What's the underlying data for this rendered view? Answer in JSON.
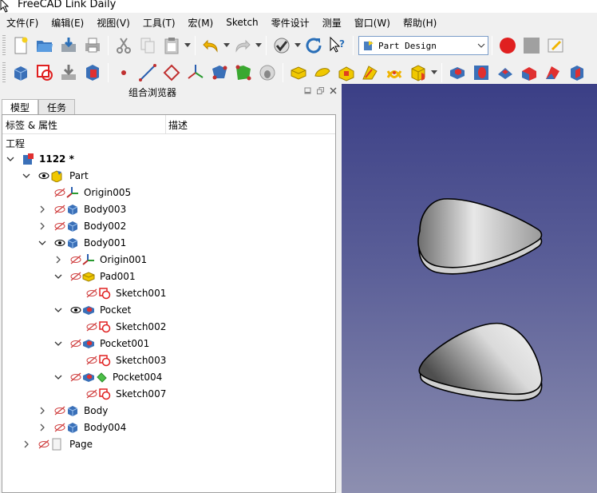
{
  "window": {
    "title": "FreeCAD Link Daily"
  },
  "menu": [
    "文件(F)",
    "编辑(E)",
    "视图(V)",
    "工具(T)",
    "宏(M)",
    "Sketch",
    "零件设计",
    "测量",
    "窗口(W)",
    "帮助(H)"
  ],
  "toolbar": {
    "workbench": "Part Design"
  },
  "panel": {
    "title": "组合浏览器",
    "tabs": [
      "模型",
      "任务"
    ],
    "columns": [
      "标签 & 属性",
      "描述"
    ],
    "section": "工程",
    "tree": [
      {
        "label": "1122 *",
        "bold": true
      },
      {
        "label": "Part"
      },
      {
        "label": "Origin005"
      },
      {
        "label": "Body003"
      },
      {
        "label": "Body002"
      },
      {
        "label": "Body001"
      },
      {
        "label": "Origin001"
      },
      {
        "label": "Pad001"
      },
      {
        "label": "Sketch001"
      },
      {
        "label": "Pocket"
      },
      {
        "label": "Sketch002"
      },
      {
        "label": "Pocket001"
      },
      {
        "label": "Sketch003"
      },
      {
        "label": "Pocket004"
      },
      {
        "label": "Sketch007"
      },
      {
        "label": "Body"
      },
      {
        "label": "Body004"
      },
      {
        "label": "Page"
      }
    ]
  },
  "colors": {
    "view_top": "#3b3f86",
    "view_bottom": "#8d8fb0",
    "tree_bg": "#ffffff"
  }
}
